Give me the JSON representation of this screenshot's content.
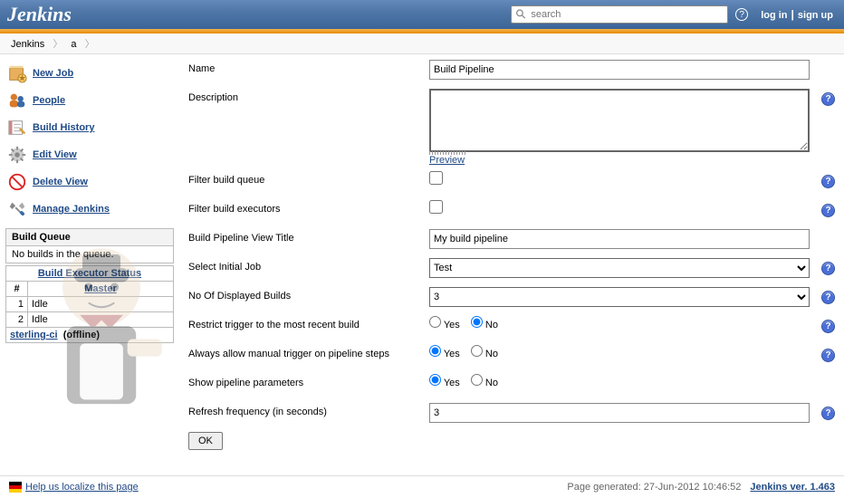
{
  "header": {
    "logo": "Jenkins",
    "search_placeholder": "search",
    "login": "log in",
    "signup": "sign up"
  },
  "breadcrumb": {
    "root": "Jenkins",
    "view": "a"
  },
  "sidebar": {
    "items": [
      {
        "label": "New Job"
      },
      {
        "label": "People"
      },
      {
        "label": "Build History"
      },
      {
        "label": "Edit View"
      },
      {
        "label": "Delete View"
      },
      {
        "label": "Manage Jenkins"
      }
    ],
    "queue_header": "Build Queue",
    "queue_body": "No builds in the queue.",
    "exec_header": "Build Executor Status",
    "exec_num": "#",
    "exec_master": "Master",
    "exec_rows": [
      {
        "num": "1",
        "status": "Idle"
      },
      {
        "num": "2",
        "status": "Idle"
      }
    ],
    "slave_name": "sterling-ci",
    "slave_status": "(offline)"
  },
  "form": {
    "name_label": "Name",
    "name_value": "Build Pipeline",
    "desc_label": "Description",
    "desc_value": "",
    "preview": "Preview",
    "filter_queue_label": "Filter build queue",
    "filter_exec_label": "Filter build executors",
    "title_label": "Build Pipeline View Title",
    "title_value": "My build pipeline",
    "initial_label": "Select Initial Job",
    "initial_value": "Test",
    "nbuilds_label": "No Of Displayed Builds",
    "nbuilds_value": "3",
    "restrict_label": "Restrict trigger to the most recent build",
    "manual_label": "Always allow manual trigger on pipeline steps",
    "params_label": "Show pipeline parameters",
    "refresh_label": "Refresh frequency (in seconds)",
    "refresh_value": "3",
    "yes": "Yes",
    "no": "No",
    "ok": "OK"
  },
  "footer": {
    "localize": "Help us localize this page",
    "generated": "Page generated: 27-Jun-2012 10:46:52",
    "version": "Jenkins ver. 1.463"
  }
}
